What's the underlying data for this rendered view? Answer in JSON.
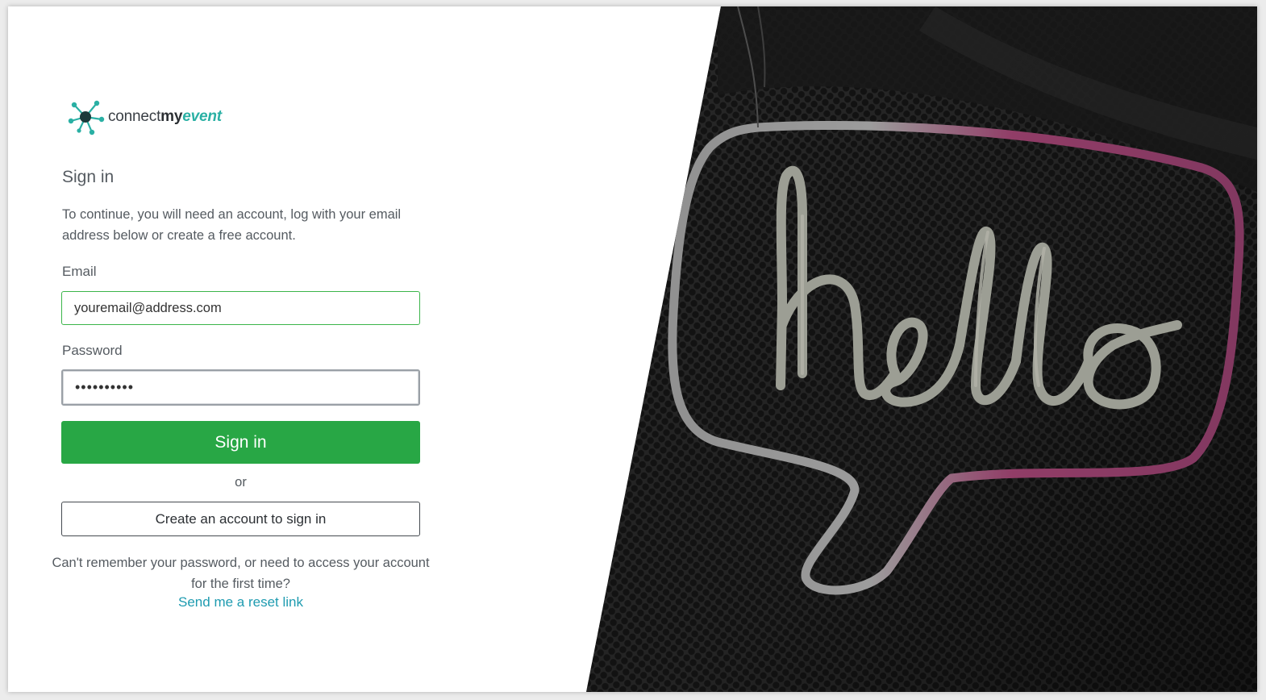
{
  "brand": {
    "name_prefix": "connect",
    "name_mid": "my",
    "name_suffix": "event",
    "accent": "#2ab0a4"
  },
  "signin": {
    "heading": "Sign in",
    "intro": "To continue, you will need an account, log with your email address below or create a free account.",
    "email_label": "Email",
    "email_value": "youremail@address.com",
    "password_label": "Password",
    "password_value": "••••••••••",
    "submit_label": "Sign in",
    "or_text": "or",
    "create_label": "Create an account to sign in",
    "help_text": "Can't remember your password, or need to access your account for the first time?",
    "reset_link": "Send me a reset link"
  },
  "colors": {
    "primary_button": "#28a745",
    "email_border": "#3bb54a",
    "link": "#1e9bb0",
    "text": "#555b61"
  },
  "hero": {
    "icon": "hello-neon-sign"
  }
}
